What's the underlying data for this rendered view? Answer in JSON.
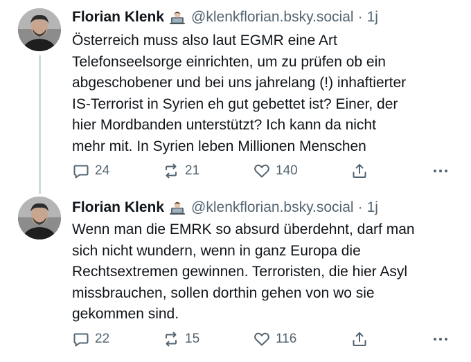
{
  "posts": [
    {
      "author": "Florian Klenk",
      "badge_icon": "technologist-emoji",
      "handle": "@klenkflorian.bsky.social",
      "separator": "·",
      "time": "1j",
      "lines": [
        "Österreich muss also laut EGMR eine Art",
        "Telefonseelsorge einrichten, um zu prüfen ob ein",
        "abgeschobener und bei uns jahrelang (!) inhaftierter",
        "IS-Terrorist in Syrien eh gut gebettet ist? Einer, der",
        "hier Mordbanden unterstützt? Ich kann da nicht",
        "mehr mit. In Syrien leben Millionen Menschen"
      ],
      "replies": "24",
      "reposts": "21",
      "likes": "140"
    },
    {
      "author": "Florian Klenk",
      "badge_icon": "technologist-emoji",
      "handle": "@klenkflorian.bsky.social",
      "separator": "·",
      "time": "1j",
      "lines": [
        "Wenn man die EMRK so absurd überdehnt, darf man",
        "sich nicht wundern, wenn in ganz Europa die",
        "Rechtsextremen gewinnen. Terroristen, die hier Asyl",
        "missbrauchen, sollen dorthin gehen von wo sie",
        "gekommen sind."
      ],
      "replies": "22",
      "reposts": "15",
      "likes": "116"
    }
  ],
  "icons": {
    "reply": "reply-icon",
    "repost": "repost-icon",
    "like": "heart-icon",
    "share": "share-icon",
    "more": "more-icon"
  },
  "colors": {
    "text": "#0f1419",
    "muted": "#536471",
    "thread_line": "#cfd9de"
  }
}
